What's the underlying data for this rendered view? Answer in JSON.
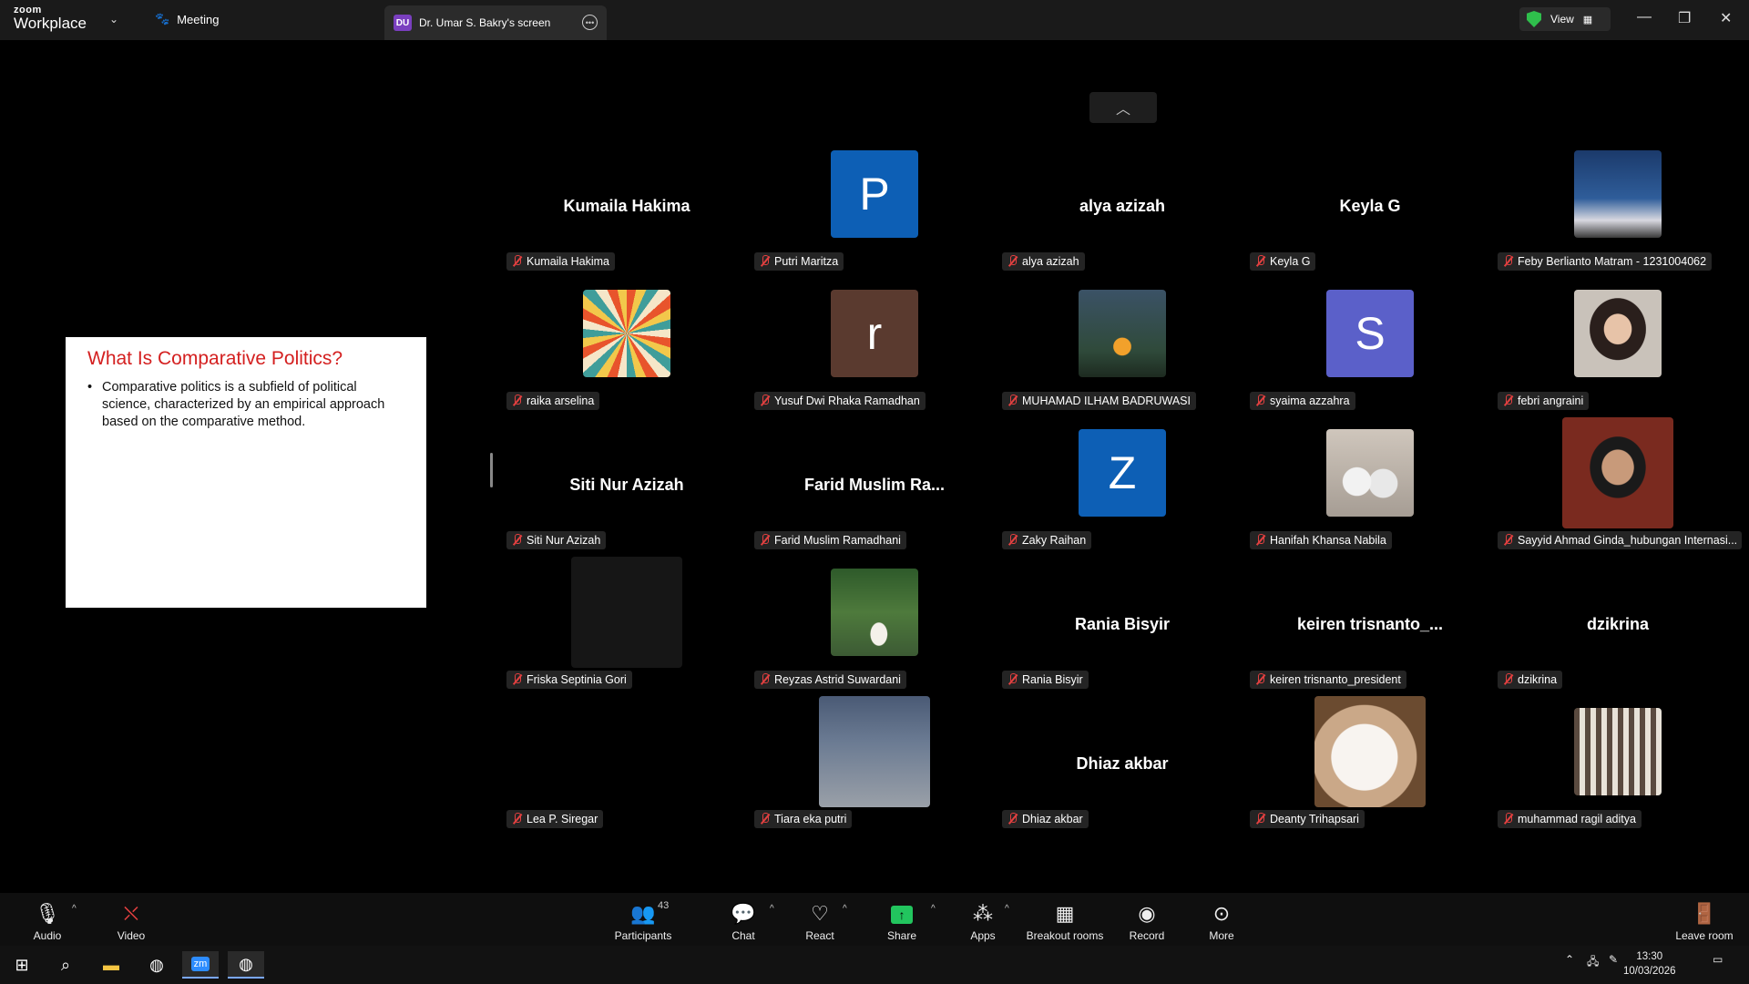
{
  "titlebar": {
    "logo_top": "zoom",
    "logo_bottom": "Workplace",
    "meeting_label": "Meeting",
    "tab_initials": "DU",
    "tab_title": "Dr. Umar S. Bakry's screen",
    "view_label": "View"
  },
  "slide": {
    "title": "What Is Comparative Politics?",
    "bullet": "Comparative politics is a subfield of political science, characterized by an empirical approach based on the comparative method."
  },
  "participants": [
    {
      "name": "Kumaila Hakima",
      "big": "Kumaila Hakima"
    },
    {
      "name": "Putri Maritza",
      "avatar_letter": "P",
      "avatar_color": "#0d5fb5"
    },
    {
      "name": "alya azizah",
      "big": "alya azizah"
    },
    {
      "name": "Keyla G",
      "big": "Keyla G"
    },
    {
      "name": "Feby Berlianto Matram - 1231004062",
      "photo": "castle"
    },
    {
      "name": "raika arselina",
      "photo": "sunburst"
    },
    {
      "name": "Yusuf Dwi Rhaka Ramadhan",
      "avatar_letter": "r",
      "avatar_color": "#5a3a2f"
    },
    {
      "name": "MUHAMAD ILHAM BADRUWASI",
      "photo": "tent"
    },
    {
      "name": "syaima azzahra",
      "avatar_letter": "S",
      "avatar_color": "#5b60c9"
    },
    {
      "name": "febri angraini",
      "photo": "portrait"
    },
    {
      "name": "Siti Nur Azizah",
      "big": "Siti Nur Azizah"
    },
    {
      "name": "Farid Muslim Ramadhani",
      "big": "Farid  Muslim  Ra..."
    },
    {
      "name": "Zaky Raihan",
      "avatar_letter": "Z",
      "avatar_color": "#0d5fb5"
    },
    {
      "name": "Hanifah Khansa Nabila",
      "photo": "cats"
    },
    {
      "name": "Sayyid Ahmad Ginda_hubungan Internasi...",
      "photo": "man"
    },
    {
      "name": "Friska Septinia Gori",
      "photo": "dark"
    },
    {
      "name": "Reyzas Astrid Suwardani",
      "photo": "garden"
    },
    {
      "name": "Rania Bisyir",
      "big": "Rania Bisyir"
    },
    {
      "name": "keiren trisnanto_president",
      "big": "keiren  trisnanto_..."
    },
    {
      "name": "dzikrina",
      "big": "dzikrina"
    },
    {
      "name": "Lea P. Siregar",
      "photo": "black"
    },
    {
      "name": "Tiara eka putri",
      "photo": "feet"
    },
    {
      "name": "Dhiaz akbar",
      "big": "Dhiaz akbar"
    },
    {
      "name": "Deanty Trihapsari",
      "photo": "fluffy"
    },
    {
      "name": "muhammad ragil aditya",
      "photo": "building"
    }
  ],
  "toolbar": {
    "audio": "Audio",
    "video": "Video",
    "participants": "Participants",
    "participants_count": "43",
    "chat": "Chat",
    "react": "React",
    "share": "Share",
    "apps": "Apps",
    "breakout": "Breakout rooms",
    "record": "Record",
    "more": "More",
    "leave": "Leave room"
  },
  "taskbar": {
    "time": "13:30",
    "date": "10/03/2026"
  }
}
